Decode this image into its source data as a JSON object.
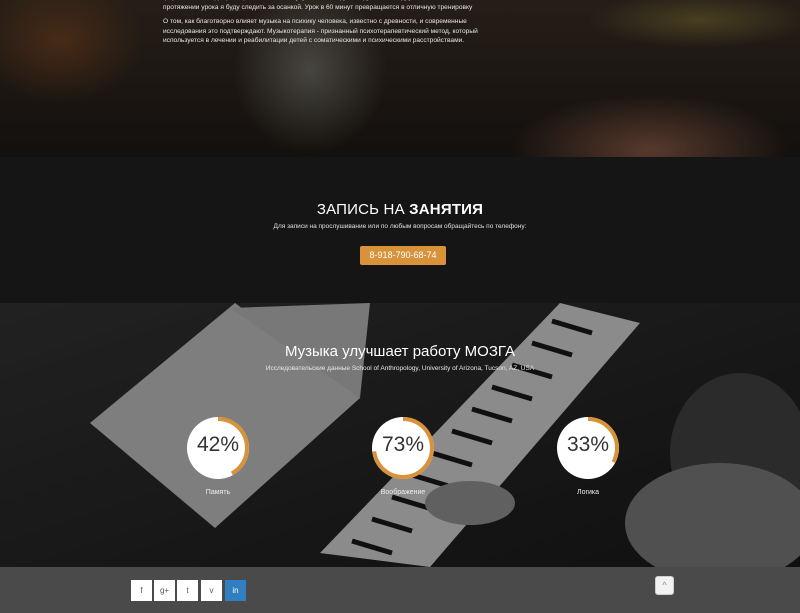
{
  "hero": {
    "paragraph1": "фортепиано всегда фиксировано. Нельзя сутулиться, нагружать руки, шею и другие части тела. На протяжении урока я буду следить за осанкой. Урок в 60 минут превращается в отличную тренировку",
    "paragraph2": "О том, как благотворно влияет музыка на психику человека, известно с древности, и современные исследования это подтверждают. Музыкотерапия - признанный психотерапевтический метод, который используется в лечении и реабилитации детей с соматическими и психическими расстройствами."
  },
  "booking": {
    "title_light": "ЗАПИСЬ НА ",
    "title_bold": "ЗАНЯТИЯ",
    "subtitle": "Для записи на прослушивание или по любым вопросам обращайтесь по телефону:",
    "phone": "8-918-790-68-74",
    "accent_color": "#d8923a"
  },
  "brain": {
    "title": "Музыка улучшает работу МОЗГА",
    "subtitle": "Исследовательские данные School of Anthropology, University of Arizona, Tucson, AZ, USA",
    "stats": [
      {
        "value_text": "42%",
        "percent": 42,
        "label": "Память"
      },
      {
        "value_text": "73%",
        "percent": 73,
        "label": "Воображение"
      },
      {
        "value_text": "33%",
        "percent": 33,
        "label": "Логика"
      }
    ],
    "ring_color": "#d8923a"
  },
  "footer": {
    "social": [
      {
        "icon": "facebook-icon",
        "glyph": "f"
      },
      {
        "icon": "google-plus-icon",
        "glyph": "g+"
      },
      {
        "icon": "twitter-icon",
        "glyph": "t"
      },
      {
        "icon": "vimeo-icon",
        "glyph": "v"
      },
      {
        "icon": "linkedin-icon",
        "glyph": "in"
      }
    ],
    "to_top_glyph": "^"
  }
}
